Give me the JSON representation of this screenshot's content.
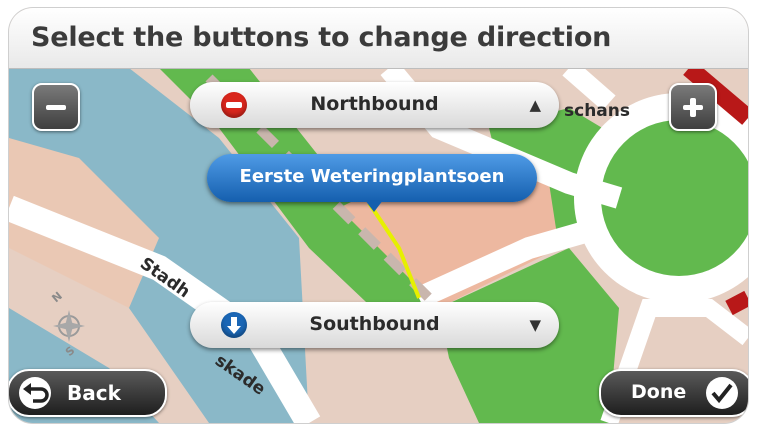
{
  "header": {
    "title": "Select the buttons to change direction"
  },
  "map": {
    "labels": {
      "schans": "schans",
      "stadh": "Stadh",
      "skade": "skade"
    },
    "compass": {
      "north": "N",
      "south": "S"
    }
  },
  "controls": {
    "zoom_out_icon": "minus-icon",
    "zoom_in_icon": "plus-icon"
  },
  "directions": {
    "north": {
      "label": "Northbound",
      "icon": "no-entry-icon",
      "arrow": "▲"
    },
    "south": {
      "label": "Southbound",
      "icon": "down-arrow-icon",
      "arrow": "▼"
    }
  },
  "street": {
    "name": "Eerste Weteringplantsoen"
  },
  "footer": {
    "back_label": "Back",
    "done_label": "Done"
  },
  "colors": {
    "water": "#8ab8c8",
    "park": "#5fbf4e",
    "land": "#e8d0c4",
    "road": "#ffffff",
    "route": "#e6f000",
    "pill_blue": "#1a66b5",
    "no_entry_red": "#d9261c"
  }
}
